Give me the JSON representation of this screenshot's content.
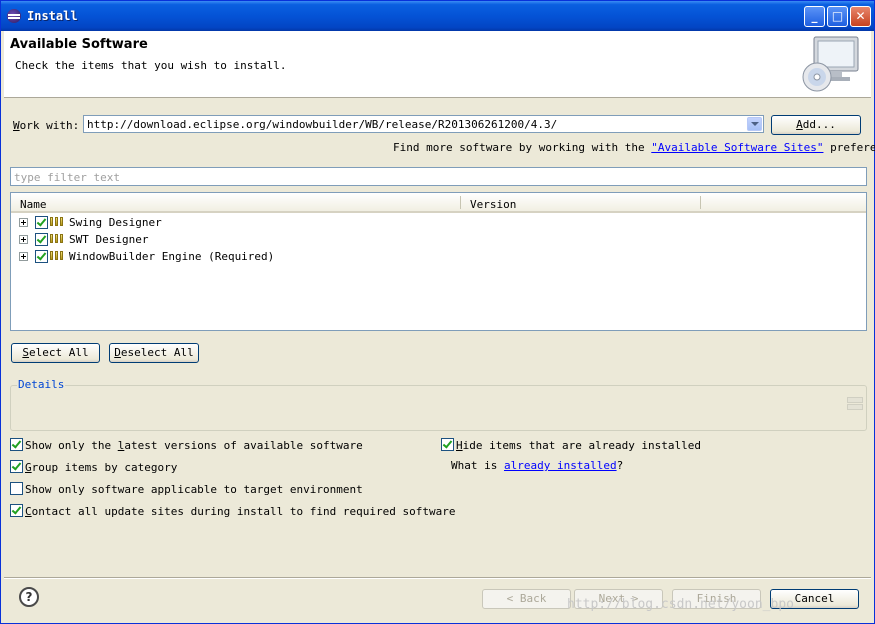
{
  "window": {
    "title": "Install"
  },
  "titlebar": {
    "min": "_",
    "max": "□",
    "close": "✕"
  },
  "header": {
    "title": "Available Software",
    "subtitle": "Check the items that you wish to install."
  },
  "work_with": {
    "label_accel": "W",
    "label_rest": "ork with:",
    "value": "http://download.eclipse.org/windowbuilder/WB/release/R201306261200/4.3/",
    "add_accel": "A",
    "add_rest": "dd..."
  },
  "find_more": {
    "prefix": "Find more software by working with the ",
    "link": "\"Available Software Sites\"",
    "suffix": " preferences."
  },
  "filter": {
    "placeholder": "type filter text"
  },
  "tree": {
    "columns": [
      "Name",
      "Version"
    ],
    "rows": [
      {
        "label": "Swing Designer",
        "checked": true
      },
      {
        "label": "SWT Designer",
        "checked": true
      },
      {
        "label": "WindowBuilder Engine (Required)",
        "checked": true
      }
    ]
  },
  "buttons": {
    "select_all_accel": "S",
    "select_all_rest": "elect All",
    "deselect_all_accel": "D",
    "deselect_all_rest": "eselect All"
  },
  "details": {
    "title": "Details"
  },
  "options": {
    "latest_a": "Show only the ",
    "latest_accel": "l",
    "latest_b": "atest versions of available software",
    "group_accel": "G",
    "group_rest": "roup items by category",
    "target": "Show only software applicable to target environment",
    "contact_accel": "C",
    "contact_rest": "ontact all update sites during install to find required software",
    "hide_accel": "H",
    "hide_rest": "ide items that are already installed",
    "what_is": "What is ",
    "already_installed": "already installed",
    "question": "?"
  },
  "option_states": {
    "latest": true,
    "group": true,
    "target": false,
    "contact": true,
    "hide": true
  },
  "footer": {
    "help": "?",
    "back": "< Back",
    "next": "Next >",
    "finish": "Finish",
    "cancel": "Cancel",
    "watermark": "http://blog.csdn.net/yoon_bpo"
  }
}
